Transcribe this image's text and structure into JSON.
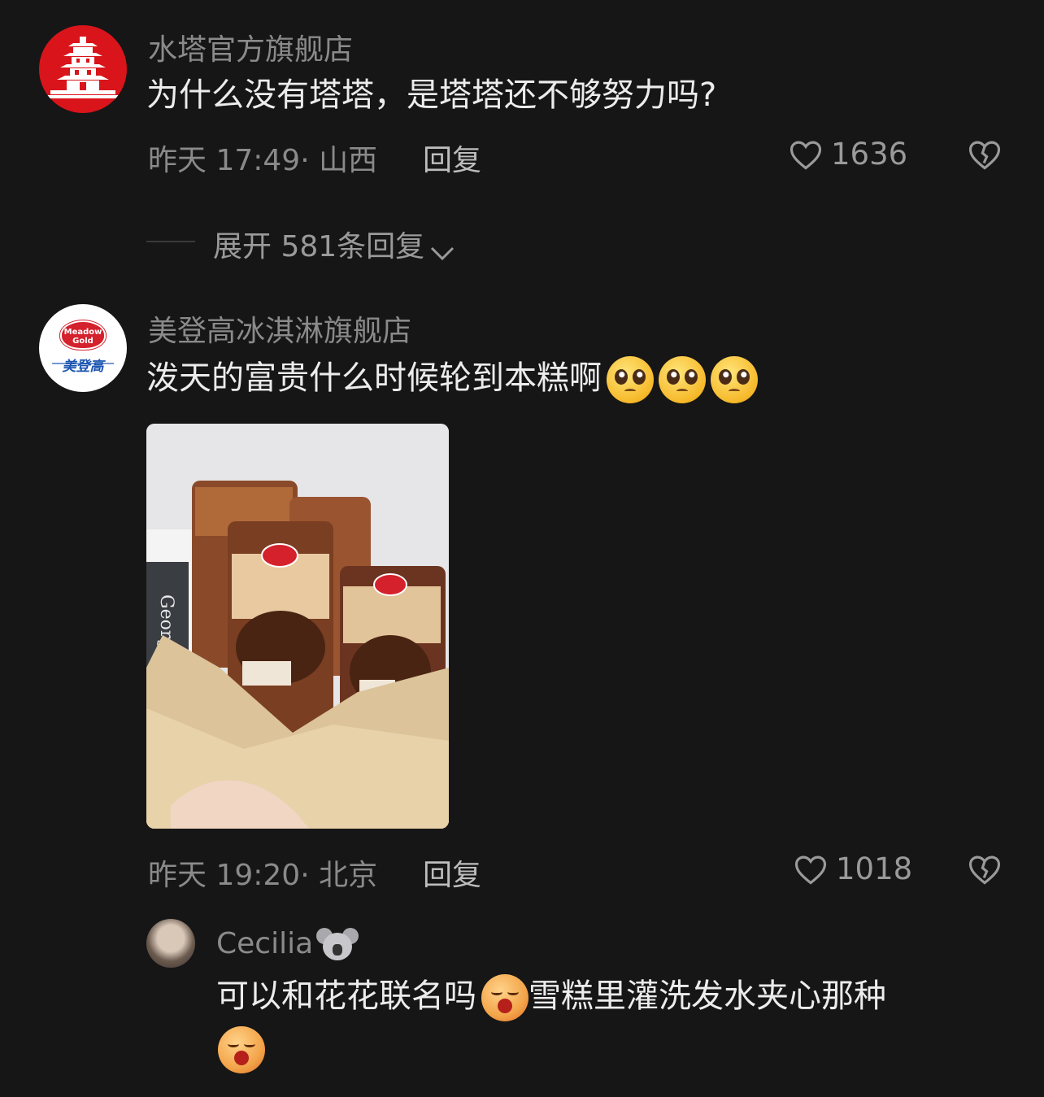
{
  "comments": [
    {
      "username": "水塔官方旗舰店",
      "content": "为什么没有塔塔，是塔塔还不够努力吗?",
      "time_location": "昨天 17:49· 山西",
      "reply_label": "回复",
      "likes": "1636"
    },
    {
      "username": "美登高冰淇淋旗舰店",
      "avatar_text_en": "Meadow Gold",
      "avatar_text_cn": "美登高",
      "content": "泼天的富贵什么时候轮到本糕啊",
      "emojis": [
        "pleading-face",
        "pleading-face",
        "pleading-face"
      ],
      "image_alt": "Meadow Gold ice cream bars in a paper bag",
      "image_text": "George",
      "time_location": "昨天 19:20· 北京",
      "reply_label": "回复",
      "likes": "1018"
    }
  ],
  "expand_replies_label": "展开 581条回复",
  "sub_reply": {
    "username": "Cecilia",
    "username_emoji": "koala",
    "content_line1": "可以和花花联名吗",
    "content_line1_after": "雪糕里灌洗发水夹心那种",
    "emojis": [
      "shouting-face",
      "shouting-face"
    ]
  },
  "colors": {
    "background": "#161616",
    "text_primary": "#ececec",
    "text_secondary": "#8a8a8a",
    "water_tower_red": "#d9141b",
    "meadow_gold_red": "#d4212c",
    "meadow_gold_blue": "#1a54b0"
  }
}
